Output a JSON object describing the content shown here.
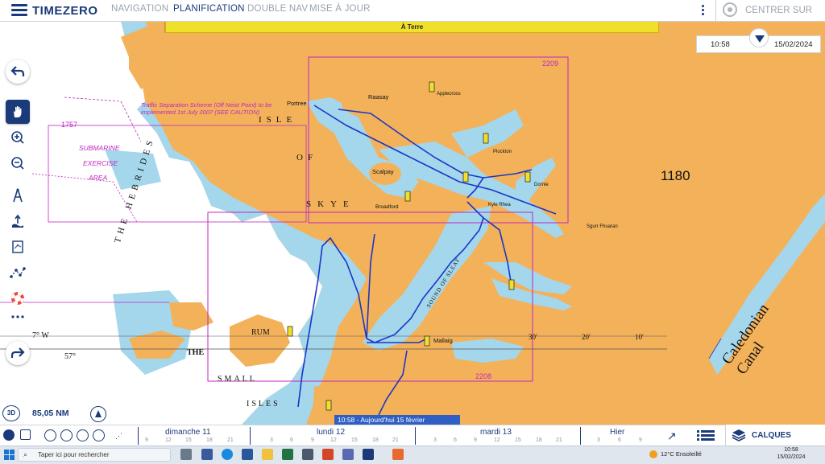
{
  "app": {
    "brand": "TIMEZERO"
  },
  "tabs": [
    {
      "label": "NAVIGATION",
      "active": false
    },
    {
      "label": "PLANIFICATION",
      "active": true
    },
    {
      "label": "DOUBLE NAV",
      "active": false
    },
    {
      "label": "MISE À JOUR",
      "active": false
    }
  ],
  "center_label": "CENTRER SUR",
  "land_warning": "À Terre",
  "time_panel": {
    "time": "10:58",
    "date": "15/02/2024"
  },
  "map": {
    "depth_label": "1180",
    "chart_numbers": [
      "2209",
      "2208",
      "1757"
    ],
    "labels": {
      "isle": "ISLE",
      "of": "OF",
      "skye": "SKYE",
      "hebrides": "THE HEBRIDES",
      "submarine": "SUBMARINE",
      "exercise": "EXERCISE",
      "area": "AREA",
      "rum": "RUM",
      "small": "SMALL",
      "isles": "ISLES",
      "the": "THE",
      "raasay": "Raasay",
      "scalpay": "Scalpay",
      "mallaig": "Mallaig",
      "sound_of_sleat": "SOUND OF SLEAT",
      "caledonian": "Caledonian Canal",
      "traffic_note": "Traffic Separation Scheme (Off Neist Point) to be implemented 1st July 2007 (SEE CAUTION)",
      "portree": "Portree",
      "broadford": "Broadford",
      "kyle": "Kyle Rhea",
      "plockton": "Plockton",
      "dornie": "Dornie",
      "applecross": "Applecross",
      "sgurr": "Sgurr Fhuaran",
      "lat_57": "57° N",
      "lon_7w": "7° W",
      "lat_w": "57°",
      "min_30": "30′",
      "min_20": "20′",
      "min_10": "10′"
    }
  },
  "scale": {
    "mode": "3D",
    "distance": "85,05 NM"
  },
  "timeline": {
    "now_label": "10:58 - Aujourd'hui 15 février",
    "days": [
      "dimanche 11",
      "lundi 12",
      "mardi 13",
      "Hier"
    ],
    "hours": [
      "9",
      "12",
      "15",
      "18",
      "21",
      "3",
      "6",
      "9",
      "12",
      "15",
      "18",
      "21",
      "3",
      "6",
      "9",
      "12",
      "15",
      "18",
      "21",
      "3",
      "6",
      "9"
    ]
  },
  "calques_label": "CALQUES",
  "taskbar": {
    "search_placeholder": "Taper ici pour rechercher",
    "weather": "12°C  Ensoleillé",
    "time": "10:58",
    "date": "15/02/2024"
  },
  "icons": [
    "menu-icon",
    "kebab-icon",
    "target-icon",
    "undo-icon",
    "hand-icon",
    "zoom-in-icon",
    "zoom-out-icon",
    "compass-icon",
    "tide-icon",
    "chart-icon",
    "route-icon",
    "lifebuoy-icon",
    "more-icon",
    "redo-icon",
    "north-icon",
    "layers-icon"
  ],
  "colors": {
    "land": "#f3b25a",
    "shallow": "#9fd4ea",
    "deep": "#ffffff",
    "route": "#1a36c8",
    "brand": "#1a3a7a",
    "magenta": "#c026c0"
  }
}
